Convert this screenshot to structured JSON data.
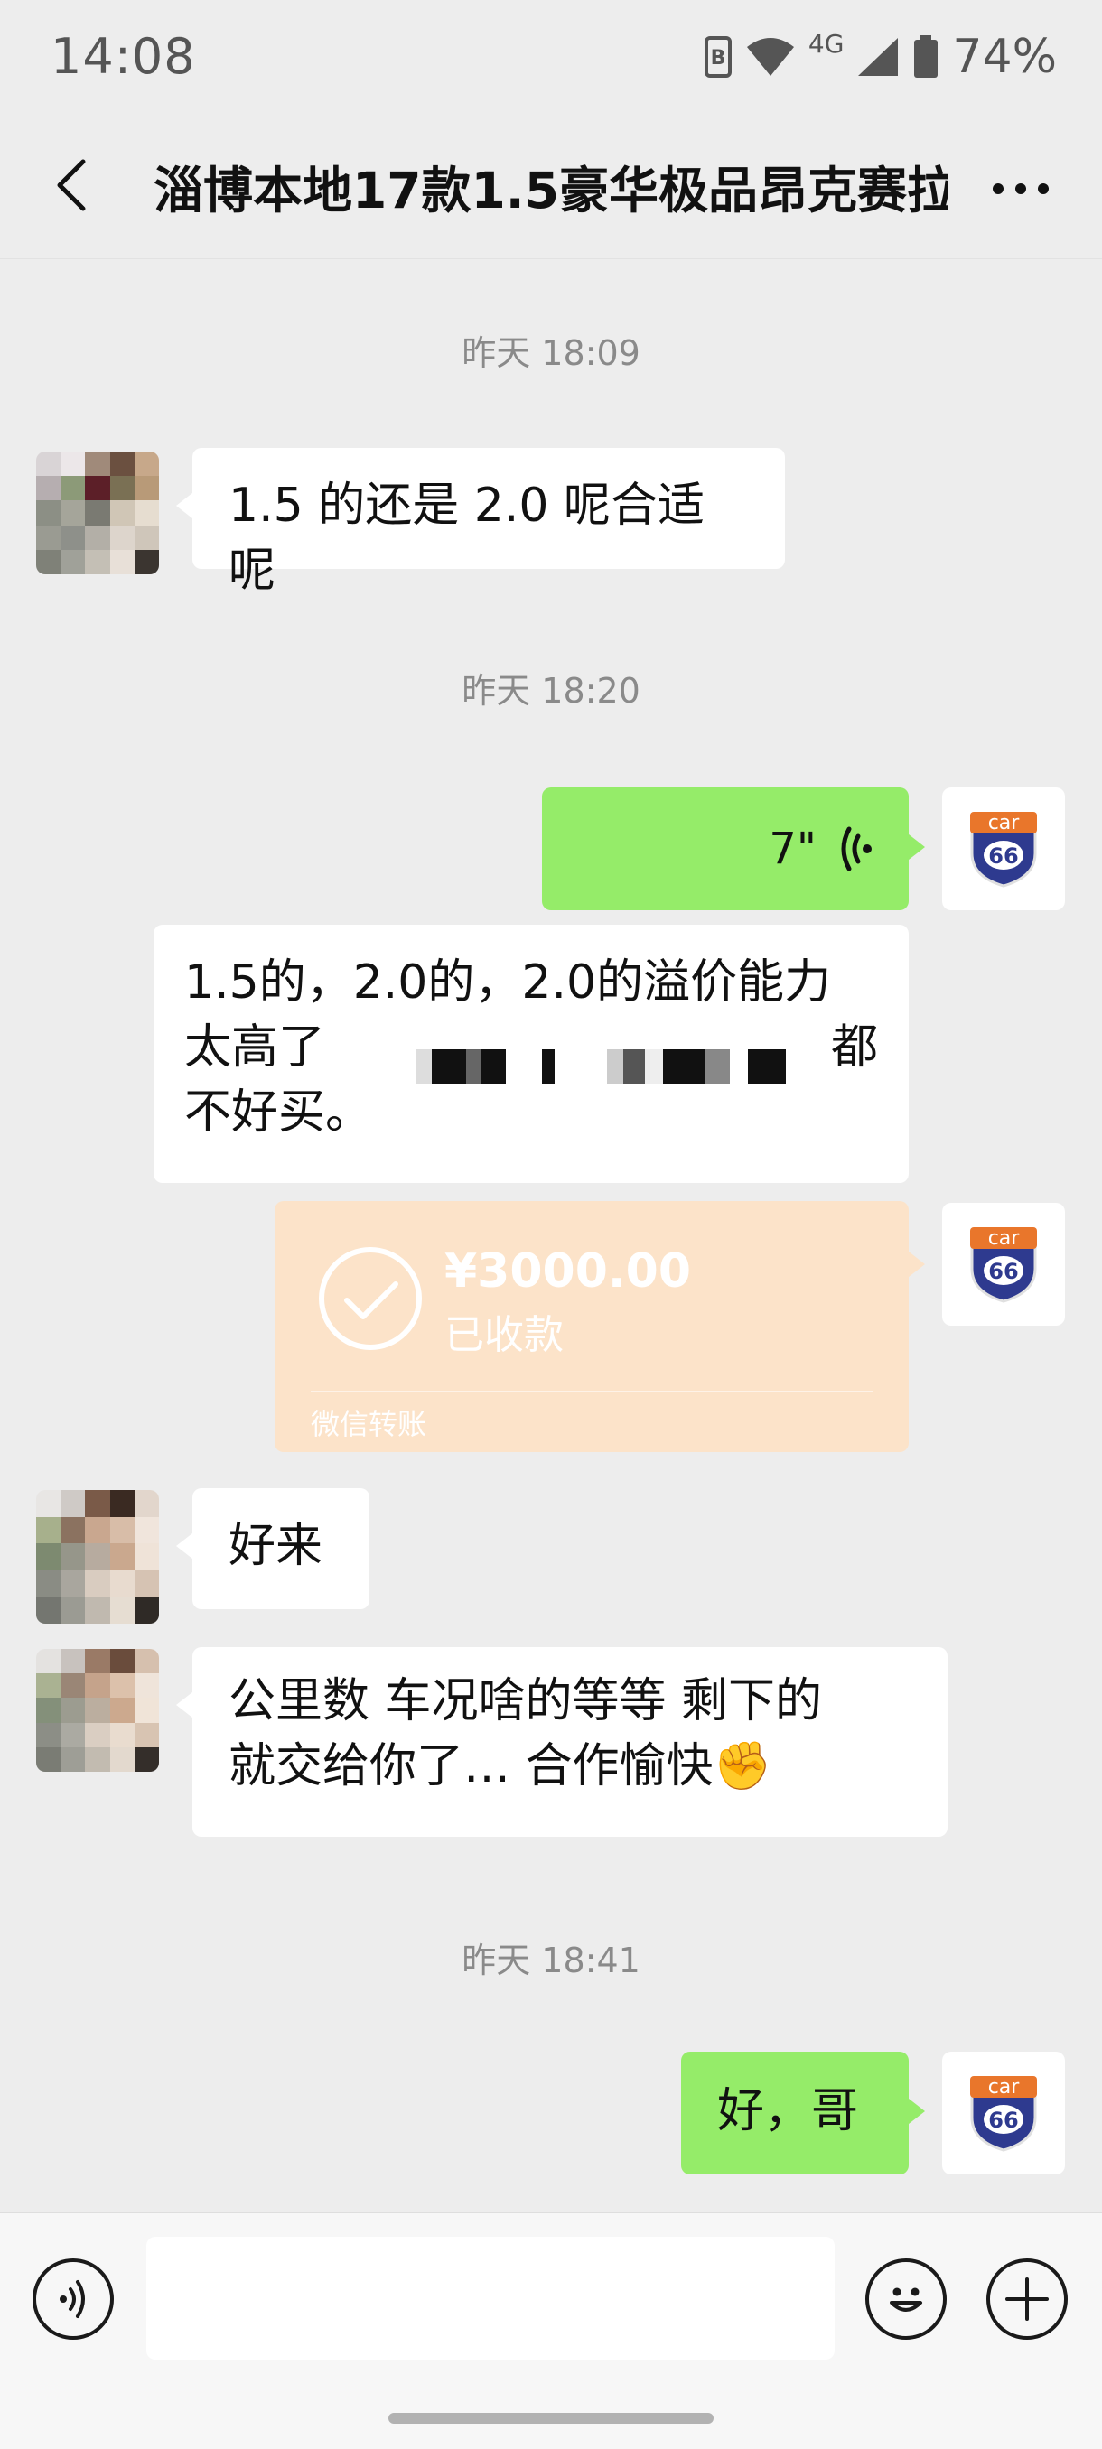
{
  "status_bar": {
    "time": "14:08",
    "network": "4G",
    "battery": "74%"
  },
  "header": {
    "title": "淄博本地17款1.5豪华极品昂克赛拉"
  },
  "messages": {
    "ts1": "昨天 18:09",
    "m1": "1.5 的还是 2.0 呢合适呢",
    "ts2": "昨天 18:20",
    "voice_duration": "7\"",
    "m3_line1": "1.5的，2.0的，2.0的溢价能力",
    "m3_line2_start": "太高了",
    "m3_line2_end": "都",
    "m3_line3": "不好买。",
    "transfer_amount": "¥3000.00",
    "transfer_status": "已收款",
    "transfer_footer": "微信转账",
    "m5": "好来",
    "m6_line1": "公里数 车况啥的等等  剩下的",
    "m6_line2": "就交给你了…  合作愉快",
    "m6_emoji": "✊",
    "ts3": "昨天 18:41",
    "m7": "好，哥"
  },
  "avatars": {
    "self_avatar_text_top": "car",
    "self_avatar_text_num": "66"
  },
  "colors": {
    "background": "#ededed",
    "bubble_out": "#95ec69",
    "bubble_in": "#ffffff",
    "transfer_card": "#fce3c9"
  }
}
